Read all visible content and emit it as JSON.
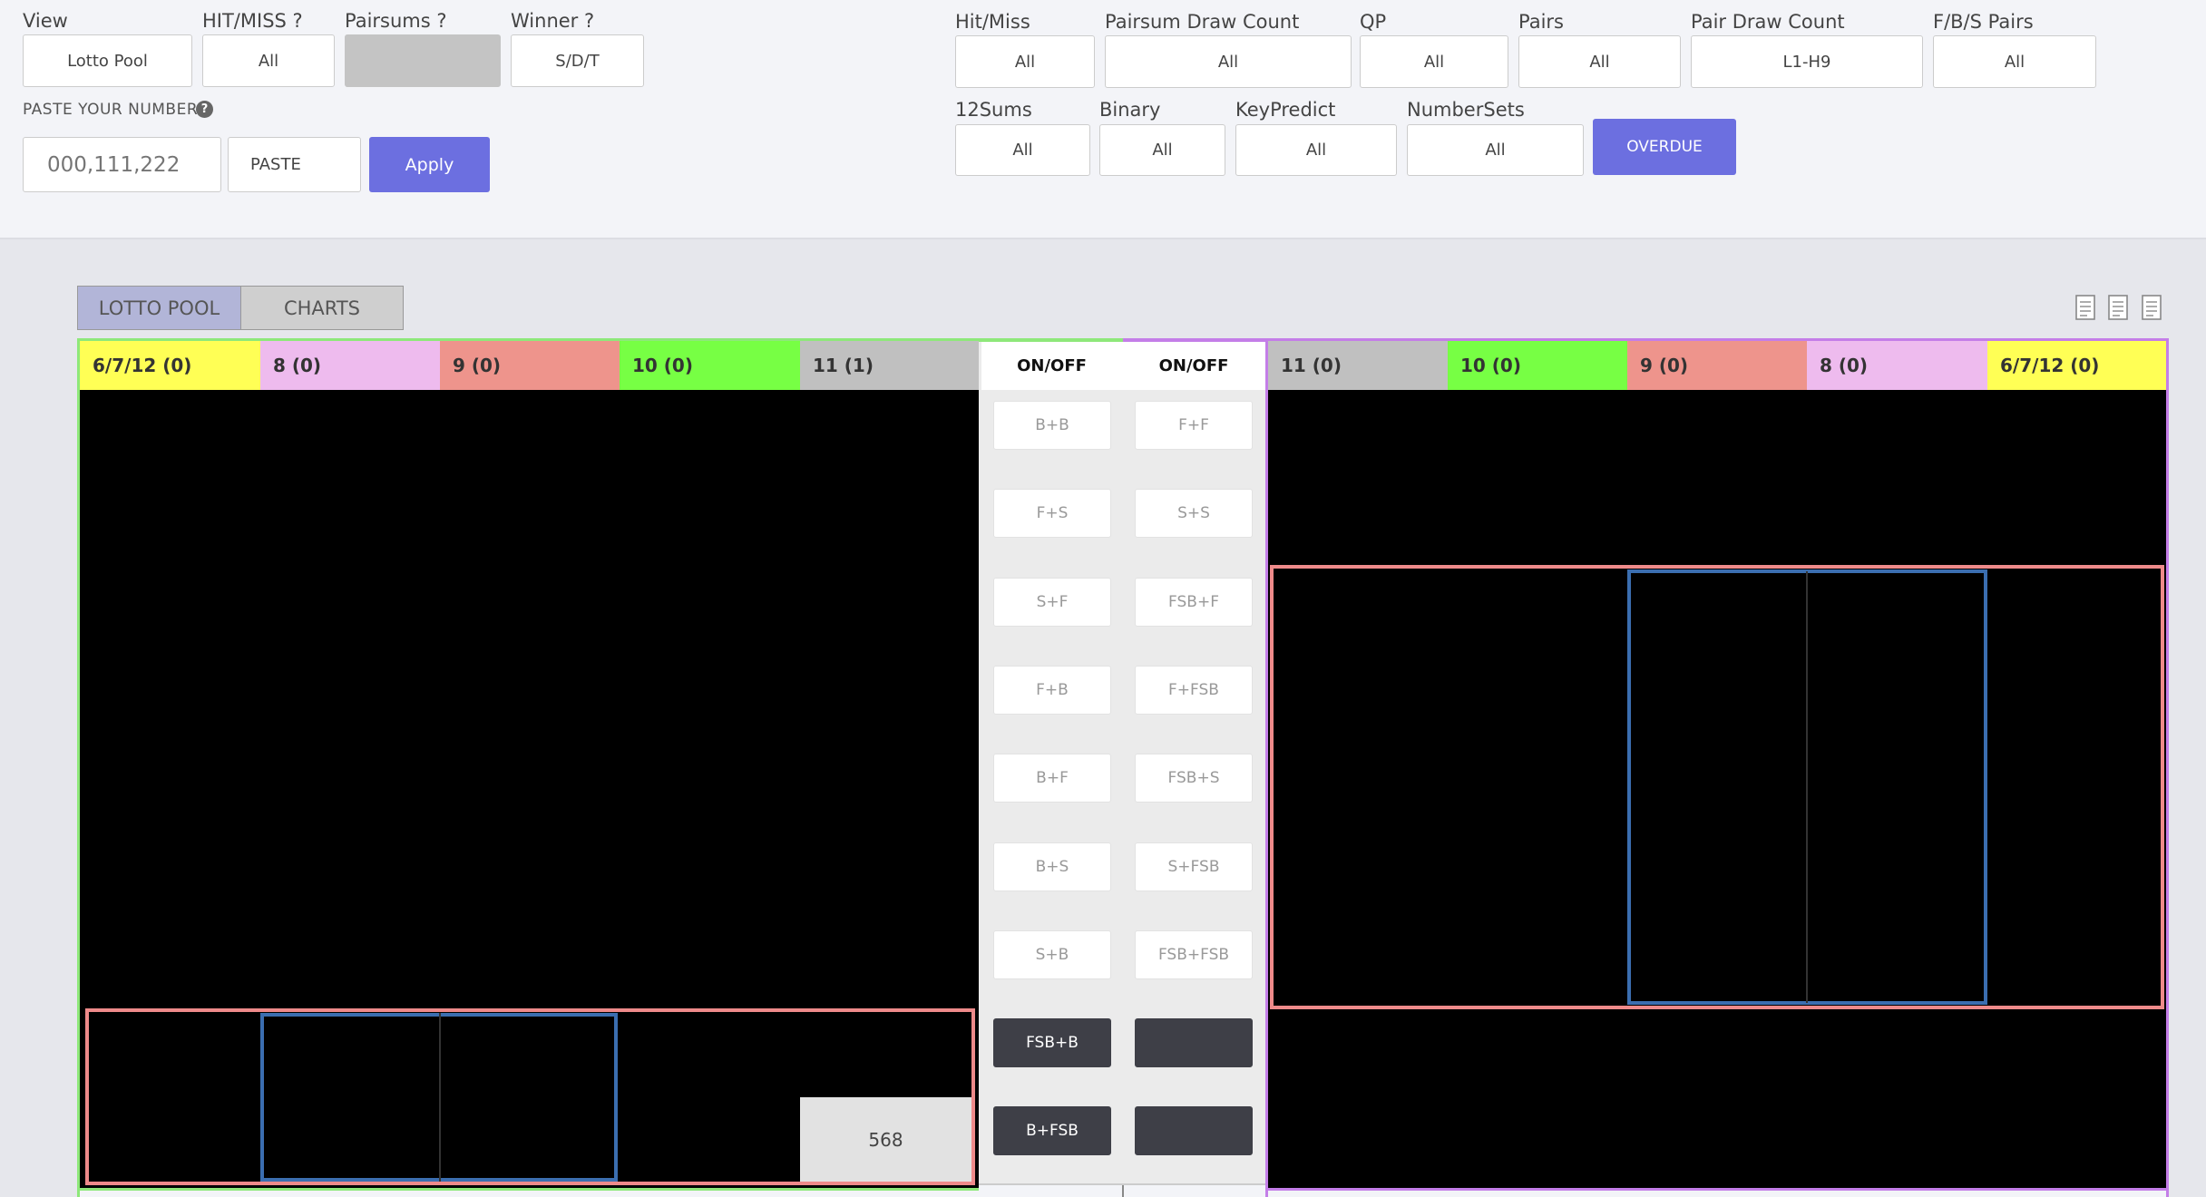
{
  "filters_left": {
    "view": {
      "label": "View",
      "value": "Lotto Pool"
    },
    "hit_miss": {
      "label": "HIT/MISS ?",
      "value": "All"
    },
    "pairsums": {
      "label": "Pairsums ?",
      "value": ""
    },
    "winner": {
      "label": "Winner ?",
      "value": "S/D/T"
    },
    "paste_label": "PASTE YOUR NUMBERS",
    "paste_input_placeholder": "000,111,222",
    "paste_button": "PASTE",
    "apply_button": "Apply"
  },
  "filters_right": {
    "hit_miss": {
      "label": "Hit/Miss",
      "value": "All"
    },
    "pairsum_draw_count": {
      "label": "Pairsum Draw Count",
      "value": "All"
    },
    "qp": {
      "label": "QP",
      "value": "All"
    },
    "pairs": {
      "label": "Pairs",
      "value": "All"
    },
    "pair_draw_count": {
      "label": "Pair Draw Count",
      "value": "L1-H9"
    },
    "fbs_pairs": {
      "label": "F/B/S Pairs",
      "value": "All"
    },
    "sums12": {
      "label": "12Sums",
      "value": "All"
    },
    "binary": {
      "label": "Binary",
      "value": "All"
    },
    "keypredict": {
      "label": "KeyPredict",
      "value": "All"
    },
    "numbersets": {
      "label": "NumberSets",
      "value": "All"
    },
    "overdue_button": "OVERDUE"
  },
  "tabs": [
    {
      "label": "LOTTO POOL",
      "active": true
    },
    {
      "label": "CHARTS",
      "active": false
    }
  ],
  "left_headers": [
    {
      "label": "6/7/12 (0)",
      "color": "#ffff55"
    },
    {
      "label": "8 (0)",
      "color": "#eebbee"
    },
    {
      "label": "9 (0)",
      "color": "#ee948c"
    },
    {
      "label": "10 (0)",
      "color": "#77ff44"
    },
    {
      "label": "11 (1)",
      "color": "#c0c0c0"
    }
  ],
  "right_headers": [
    {
      "label": "11 (0)",
      "color": "#c0c0c0"
    },
    {
      "label": "10 (0)",
      "color": "#77ff44"
    },
    {
      "label": "9 (0)",
      "color": "#ee948c"
    },
    {
      "label": "8 (0)",
      "color": "#eebbee"
    },
    {
      "label": "6/7/12 (0)",
      "color": "#ffff55"
    }
  ],
  "center": {
    "col1_header": "ON/OFF",
    "col2_header": "ON/OFF",
    "col1_buttons": [
      "B+B",
      "F+S",
      "S+F",
      "F+B",
      "B+F",
      "B+S",
      "S+B",
      "FSB+B",
      "B+FSB"
    ],
    "col2_buttons": [
      "F+F",
      "S+S",
      "FSB+F",
      "F+FSB",
      "FSB+S",
      "S+FSB",
      "FSB+FSB",
      "",
      ""
    ]
  },
  "count_cell": "568",
  "colors": {
    "accent": "#6c6fe0",
    "left_panel_border": "#8ee87a",
    "right_panel_border": "#c47ee8",
    "inner_border": "#ee8a8a",
    "highlight_border": "#3b6eb0"
  }
}
